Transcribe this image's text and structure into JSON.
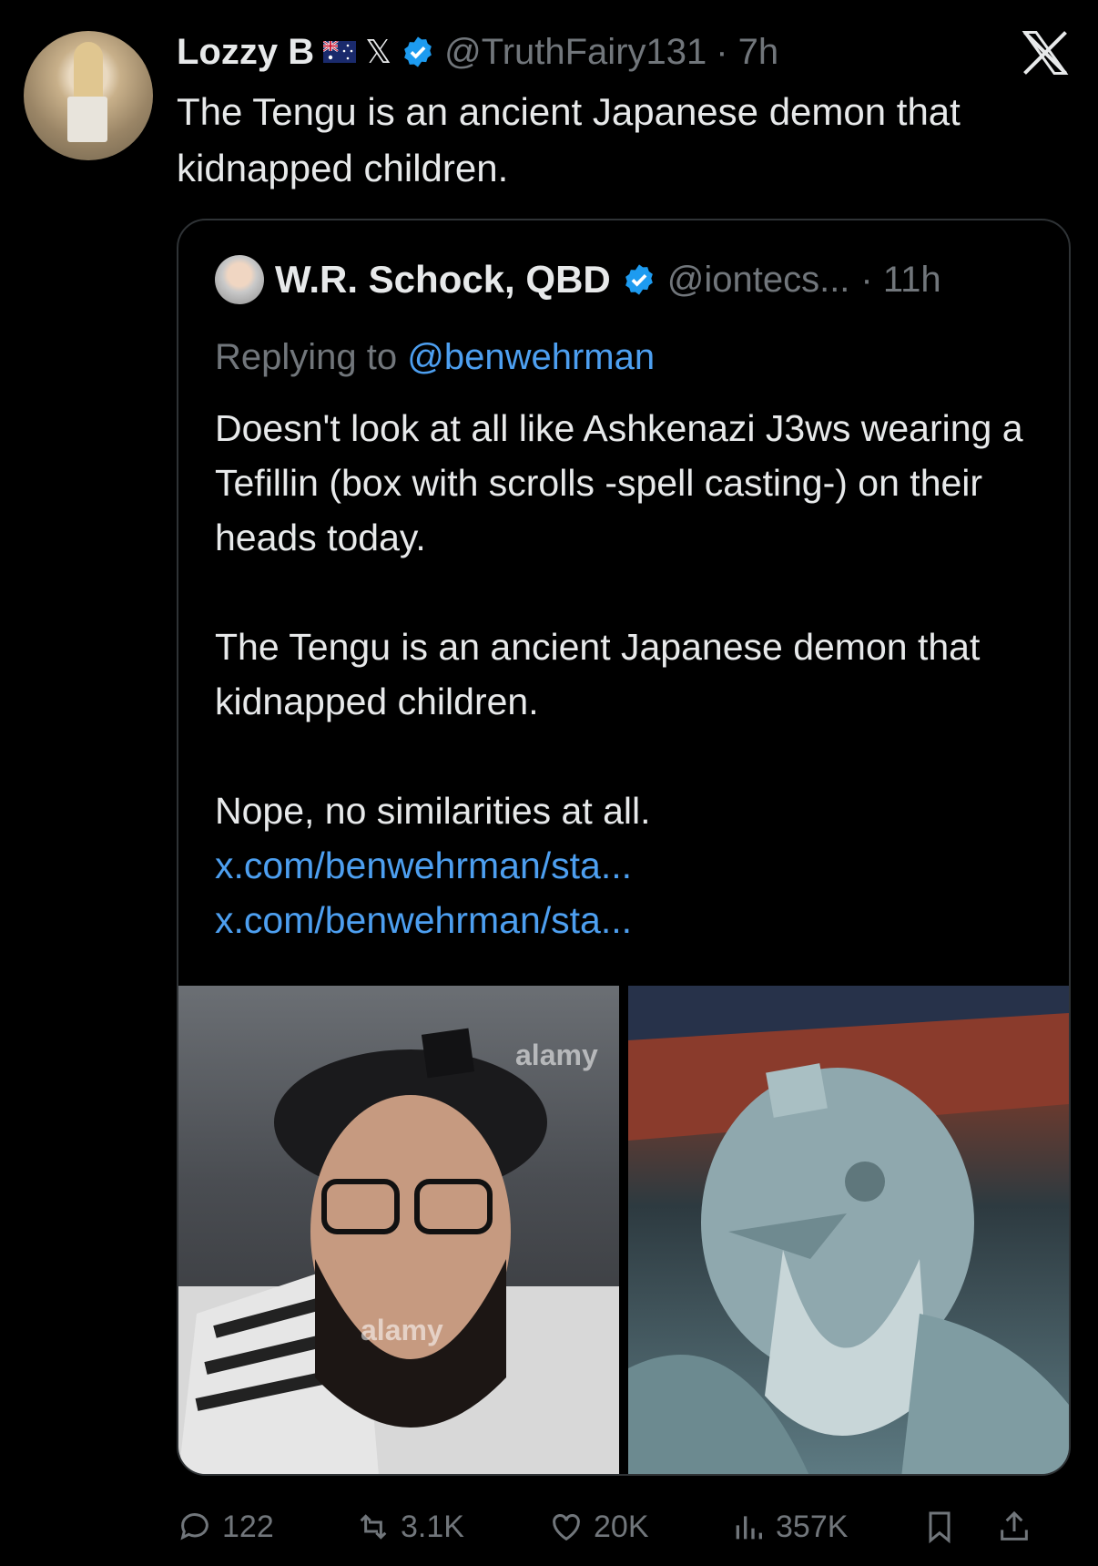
{
  "tweet": {
    "author_name": "Lozzy B",
    "x_badge": "𝕏",
    "handle": "@TruthFairy131",
    "time": "· 7h",
    "text": "The Tengu is an ancient Japanese demon that kidnapped children."
  },
  "quote": {
    "author_name": "W.R. Schock, QBD",
    "handle": "@iontecs...",
    "time": "· 11h",
    "replying_label": "Replying to",
    "replying_to": "@benwehrman",
    "paragraph1": "Doesn't look at all like Ashkenazi J3ws wearing a Tefillin (box with scrolls -spell casting-) on their heads today.",
    "paragraph2": "The Tengu is an ancient Japanese demon that kidnapped children.",
    "paragraph3": "Nope, no similarities at all.",
    "link1": "x.com/benwehrman/sta...",
    "link2": "x.com/benwehrman/sta...",
    "watermarks": [
      "alamy",
      "alamy"
    ]
  },
  "actions": {
    "replies": "122",
    "reposts": "3.1K",
    "likes": "20K",
    "views": "357K"
  },
  "colors": {
    "background": "#000000",
    "text": "#e7e9ea",
    "muted": "#71767b",
    "link": "#4d9ff0",
    "verified": "#1d9bf0"
  },
  "icons": [
    "x-logo-icon",
    "verified-badge-icon",
    "australia-flag-icon",
    "reply-icon",
    "repost-icon",
    "like-icon",
    "views-icon",
    "bookmark-icon",
    "share-icon"
  ]
}
